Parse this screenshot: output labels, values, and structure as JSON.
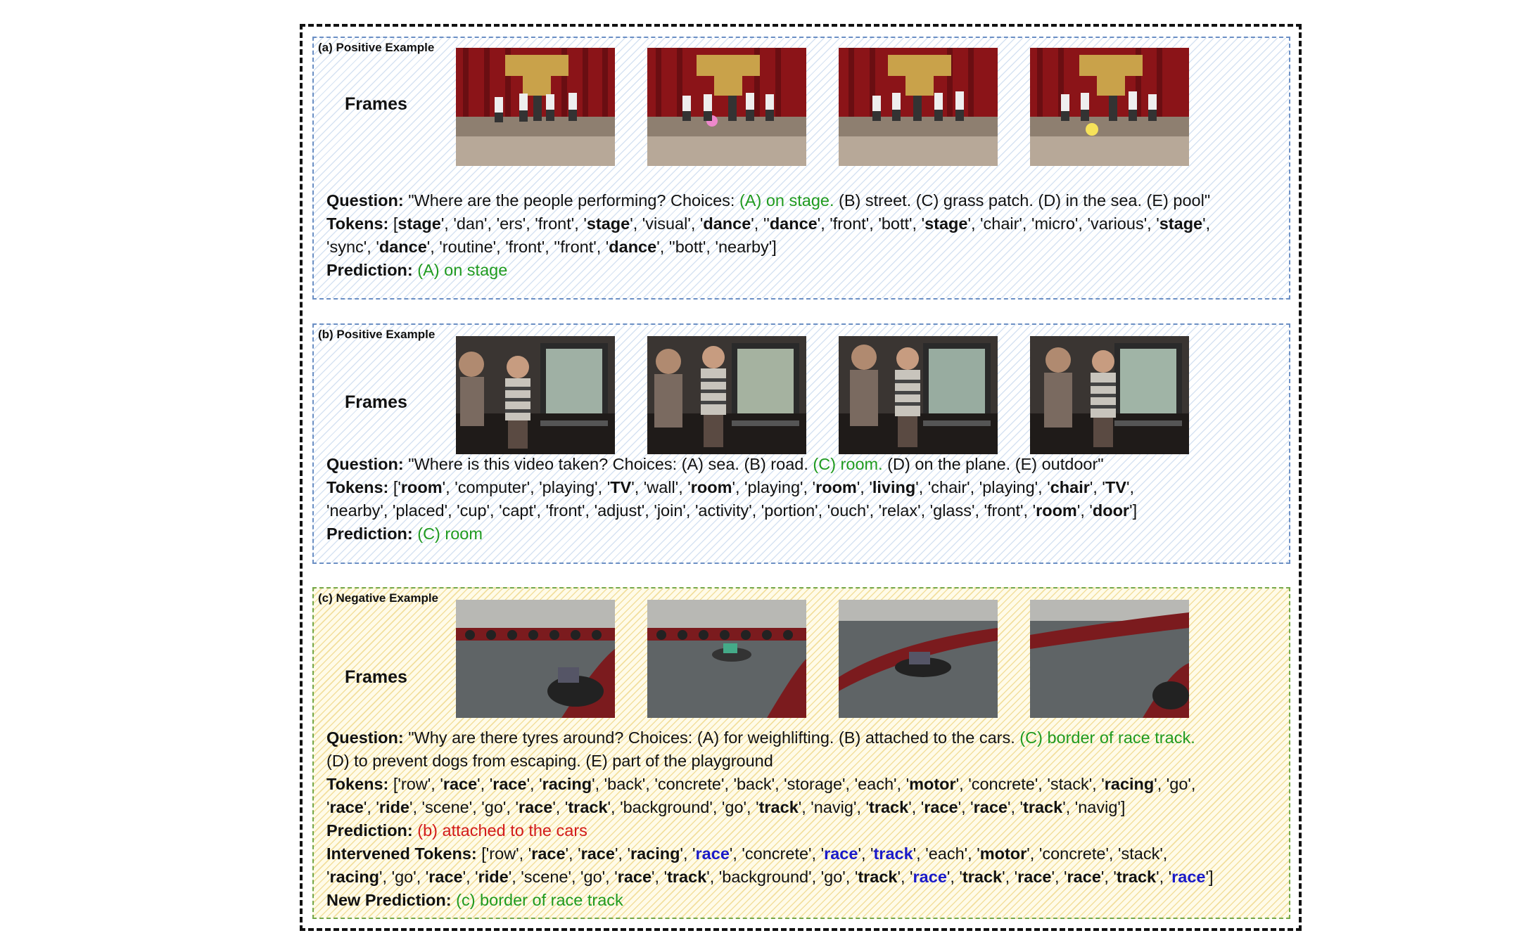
{
  "panels": {
    "a": {
      "label": "(a) Positive Example",
      "frames_label": "Frames",
      "frame_icons": [
        "stage-dance-frame-1",
        "stage-dance-frame-2",
        "stage-dance-frame-3",
        "stage-dance-frame-4"
      ],
      "question_key": "Question:",
      "question_pre": "\"Where are the people performing? Choices: ",
      "question_correct": "(A) on stage.",
      "question_post": " (B) street. (C) grass patch. (D) in the sea. (E) pool\"",
      "tokens_key": "Tokens:",
      "prediction_key": "Prediction:",
      "prediction": "(A) on stage"
    },
    "b": {
      "label": "(b) Positive Example",
      "frames_label": "Frames",
      "frame_icons": [
        "room-child-frame-1",
        "room-child-frame-2",
        "room-child-frame-3",
        "room-child-frame-4"
      ],
      "question_key": "Question:",
      "question_pre": "\"Where is this video taken? Choices: (A) sea. (B) road. ",
      "question_correct": "(C) room.",
      "question_post": " (D) on the plane. (E) outdoor\"",
      "tokens_key": "Tokens:",
      "prediction_key": "Prediction:",
      "prediction": "(C) room"
    },
    "c": {
      "label": "(c) Negative Example",
      "frames_label": "Frames",
      "frame_icons": [
        "go-kart-frame-1",
        "go-kart-frame-2",
        "go-kart-frame-3",
        "go-kart-frame-4"
      ],
      "question_key": "Question:",
      "question_pre": "\"Why are there tyres around? Choices: (A) for weighlifting. (B) attached to the cars. ",
      "question_correct": "(C) border of race track.",
      "question_line2": "(D) to prevent dogs from escaping. (E) part of the playground",
      "tokens_key": "Tokens:",
      "prediction_key": "Prediction:",
      "prediction_wrong": "(b) attached to the cars",
      "intervened_key": "Intervened Tokens:",
      "new_prediction_key": "New Prediction:",
      "new_prediction": "(c) border of race track"
    }
  },
  "tokens": {
    "a_line1": [
      {
        "t": "[",
        "b": false
      },
      {
        "t": "stage",
        "b": true
      },
      {
        "t": "', 'dan', 'ers', 'front', '",
        "b": false
      },
      {
        "t": "stage",
        "b": true
      },
      {
        "t": "', 'visual', '",
        "b": false
      },
      {
        "t": "dance",
        "b": true
      },
      {
        "t": "', ''",
        "b": false
      },
      {
        "t": "dance",
        "b": true
      },
      {
        "t": "', 'front', 'bott', '",
        "b": false
      },
      {
        "t": "stage",
        "b": true
      },
      {
        "t": "', 'chair', 'micro', 'various', '",
        "b": false
      },
      {
        "t": "stage",
        "b": true
      },
      {
        "t": "',",
        "b": false
      }
    ],
    "a_line2": [
      {
        "t": "'sync', '",
        "b": false
      },
      {
        "t": "dance",
        "b": true
      },
      {
        "t": "', 'routine', 'front', ''front', '",
        "b": false
      },
      {
        "t": "dance",
        "b": true
      },
      {
        "t": "', ''bott', 'nearby']",
        "b": false
      }
    ],
    "b_line1": [
      {
        "t": "['",
        "b": false
      },
      {
        "t": "room",
        "b": true
      },
      {
        "t": "', 'computer', 'playing', '",
        "b": false
      },
      {
        "t": "TV",
        "b": true
      },
      {
        "t": "', 'wall', '",
        "b": false
      },
      {
        "t": "room",
        "b": true
      },
      {
        "t": "', 'playing', '",
        "b": false
      },
      {
        "t": "room",
        "b": true
      },
      {
        "t": "', '",
        "b": false
      },
      {
        "t": "living",
        "b": true
      },
      {
        "t": "', 'chair', 'playing', '",
        "b": false
      },
      {
        "t": "chair",
        "b": true
      },
      {
        "t": "', '",
        "b": false
      },
      {
        "t": "TV",
        "b": true
      },
      {
        "t": "',",
        "b": false
      }
    ],
    "b_line2": [
      {
        "t": "'nearby', 'placed', 'cup', 'capt',  'front', 'adjust', 'join', 'activity', 'portion', 'ouch', 'relax', 'glass', 'front', '",
        "b": false
      },
      {
        "t": "room",
        "b": true
      },
      {
        "t": "', '",
        "b": false
      },
      {
        "t": "door",
        "b": true
      },
      {
        "t": "']",
        "b": false
      }
    ],
    "c_line1": [
      {
        "t": "['row', '",
        "b": false
      },
      {
        "t": "race",
        "b": true
      },
      {
        "t": "', '",
        "b": false
      },
      {
        "t": "race",
        "b": true
      },
      {
        "t": "', '",
        "b": false
      },
      {
        "t": "racing",
        "b": true
      },
      {
        "t": "', 'back', 'concrete', 'back', 'storage', 'each', '",
        "b": false
      },
      {
        "t": "motor",
        "b": true
      },
      {
        "t": "', 'concrete', 'stack', '",
        "b": false
      },
      {
        "t": "racing",
        "b": true
      },
      {
        "t": "', 'go',",
        "b": false
      }
    ],
    "c_line2": [
      {
        "t": "'",
        "b": false
      },
      {
        "t": "race",
        "b": true
      },
      {
        "t": "', '",
        "b": false
      },
      {
        "t": "ride",
        "b": true
      },
      {
        "t": "', 'scene', 'go', '",
        "b": false
      },
      {
        "t": "race",
        "b": true
      },
      {
        "t": "', '",
        "b": false
      },
      {
        "t": "track",
        "b": true
      },
      {
        "t": "', 'background', 'go', '",
        "b": false
      },
      {
        "t": "track",
        "b": true
      },
      {
        "t": "', 'navig', '",
        "b": false
      },
      {
        "t": "track",
        "b": true
      },
      {
        "t": "', '",
        "b": false
      },
      {
        "t": "race",
        "b": true
      },
      {
        "t": "', '",
        "b": false
      },
      {
        "t": "race",
        "b": true
      },
      {
        "t": "', '",
        "b": false
      },
      {
        "t": "track",
        "b": true
      },
      {
        "t": "', 'navig']",
        "b": false
      }
    ],
    "c_int1": [
      {
        "t": "['row', '",
        "b": false
      },
      {
        "t": "race",
        "b": true
      },
      {
        "t": "', '",
        "b": false
      },
      {
        "t": "race",
        "b": true
      },
      {
        "t": "', '",
        "b": false
      },
      {
        "t": "racing",
        "b": true
      },
      {
        "t": "', '",
        "b": false
      },
      {
        "t": "race",
        "b": true,
        "blue": true
      },
      {
        "t": "', 'concrete', '",
        "b": false
      },
      {
        "t": "race",
        "b": true,
        "blue": true
      },
      {
        "t": "', '",
        "b": false
      },
      {
        "t": "track",
        "b": true,
        "blue": true
      },
      {
        "t": "', 'each', '",
        "b": false
      },
      {
        "t": "motor",
        "b": true
      },
      {
        "t": "', 'concrete', 'stack',",
        "b": false
      }
    ],
    "c_int2": [
      {
        "t": "'",
        "b": false
      },
      {
        "t": "racing",
        "b": true
      },
      {
        "t": "', 'go', '",
        "b": false
      },
      {
        "t": "race",
        "b": true
      },
      {
        "t": "', '",
        "b": false
      },
      {
        "t": "ride",
        "b": true
      },
      {
        "t": "', 'scene', 'go', '",
        "b": false
      },
      {
        "t": "race",
        "b": true
      },
      {
        "t": "', '",
        "b": false
      },
      {
        "t": "track",
        "b": true
      },
      {
        "t": "', 'background', 'go', '",
        "b": false
      },
      {
        "t": "track",
        "b": true
      },
      {
        "t": "', '",
        "b": false
      },
      {
        "t": "race",
        "b": true,
        "blue": true
      },
      {
        "t": "', '",
        "b": false
      },
      {
        "t": "track",
        "b": true
      },
      {
        "t": "', '",
        "b": false
      },
      {
        "t": "race",
        "b": true
      },
      {
        "t": "', '",
        "b": false
      },
      {
        "t": "race",
        "b": true
      },
      {
        "t": "', '",
        "b": false
      },
      {
        "t": "track",
        "b": true
      },
      {
        "t": "', '",
        "b": false
      },
      {
        "t": "race",
        "b": true,
        "blue": true
      },
      {
        "t": "']",
        "b": false
      }
    ]
  },
  "colors": {
    "correct": "#1f9a1f",
    "wrong": "#d21a1a",
    "intervened": "#1a1ac8"
  }
}
